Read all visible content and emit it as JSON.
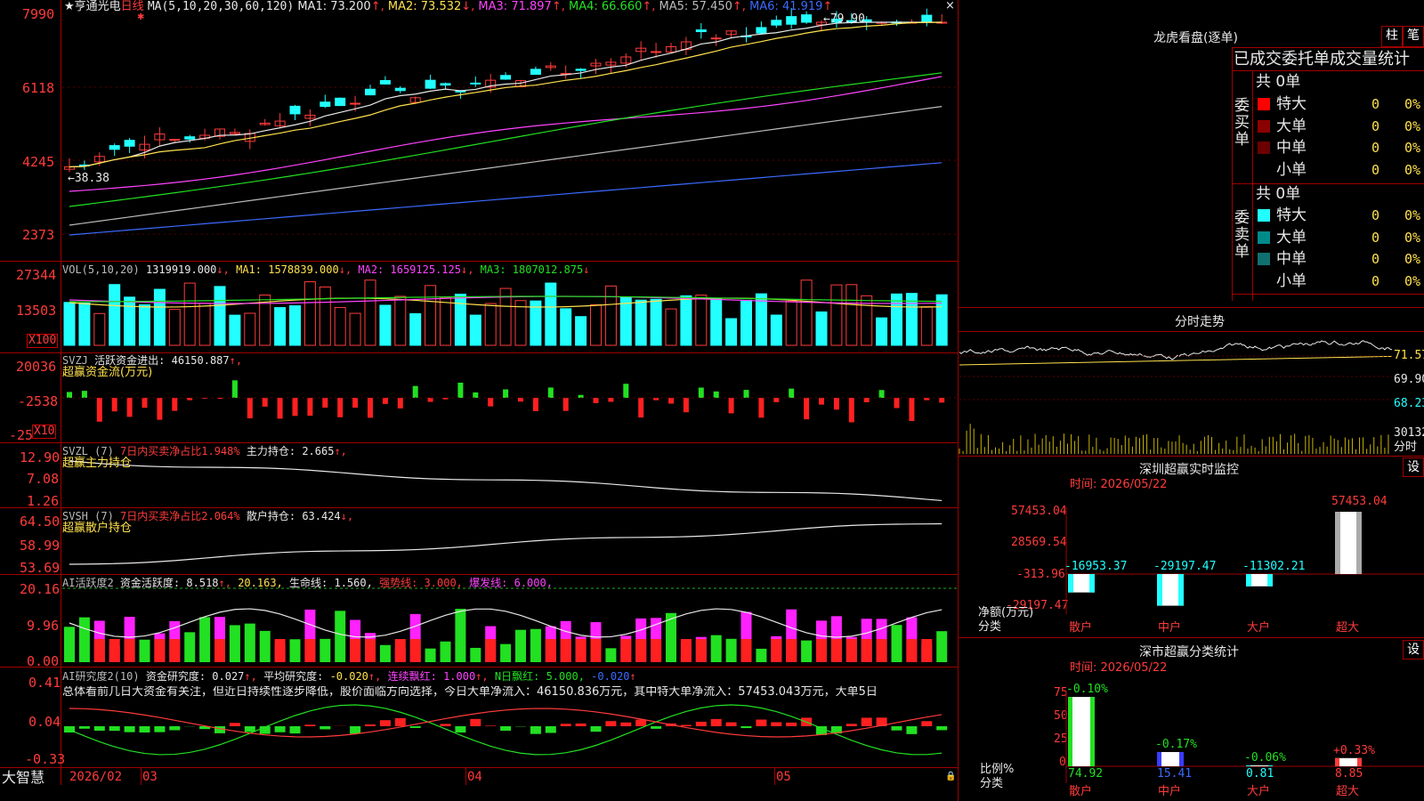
{
  "main": {
    "stock_name": "★亨通光电",
    "period": "日线",
    "ma_label": "MA(5,10,20,30,60,120)",
    "ma_values": [
      {
        "label": "MA1:",
        "value": "73.200",
        "arrow": "↑",
        "color": "#e8e8e8"
      },
      {
        "label": "MA2:",
        "value": "73.532",
        "arrow": "↓",
        "color": "#ffe14d"
      },
      {
        "label": "MA3:",
        "value": "71.897",
        "arrow": "↑",
        "color": "#ff44ff"
      },
      {
        "label": "MA4:",
        "value": "66.660",
        "arrow": "↑",
        "color": "#22e022"
      },
      {
        "label": "MA5:",
        "value": "57.450",
        "arrow": "↑",
        "color": "#bbbbbb"
      },
      {
        "label": "MA6:",
        "value": "41.919",
        "arrow": "↑",
        "color": "#3b6bff"
      }
    ],
    "y_labels": [
      "7990",
      "6118",
      "4245",
      "2373"
    ],
    "high_mark": "79.90",
    "low_mark": "38.38"
  },
  "vol": {
    "label": "VOL(5,10,20)",
    "value": "1319919.000",
    "ma": [
      {
        "label": "MA1:",
        "value": "1578839.000",
        "arrow": "↓",
        "color": "#ffe14d"
      },
      {
        "label": "MA2:",
        "value": "1659125.125",
        "arrow": "↓",
        "color": "#ff44ff"
      },
      {
        "label": "MA3:",
        "value": "1807012.875",
        "arrow": "↓",
        "color": "#22e022"
      }
    ],
    "y_labels": [
      "27344",
      "13503"
    ],
    "unit": "X100"
  },
  "svzj": {
    "label": "SVZJ",
    "desc": "活跃资金进出:",
    "value": "46150.887",
    "arrow": "↑,",
    "sub": "超赢资金流(万元)",
    "y_labels": [
      "20036",
      "-2538",
      "-25"
    ],
    "unit": "X10"
  },
  "svzl": {
    "label": "SVZL (7)",
    "desc": "7日内买卖净占比1.948%",
    "desc2": "主力持仓:",
    "value": "2.665",
    "arrow": "↑,",
    "sub": "超赢主力持仓",
    "y_labels": [
      "12.90",
      "7.08",
      "1.26"
    ]
  },
  "svsh": {
    "label": "SVSH (7)",
    "desc": "7日内买卖净占比2.064%",
    "desc2": "散户持仓:",
    "value": "63.424",
    "arrow": "↓,",
    "sub": "超赢散户持仓",
    "y_labels": [
      "64.50",
      "58.99",
      "53.69"
    ]
  },
  "ai1": {
    "label": "AI活跃度2",
    "desc": "资金活跃度:",
    "value": "8.518",
    "v2": "20.163,",
    "life_label": "生命线:",
    "life_value": "1.560,",
    "strong_label": "强势线:",
    "strong_value": "3.000,",
    "burst_label": "爆发线:",
    "burst_value": "6.000,",
    "y_labels": [
      "20.16",
      "9.96",
      "0.00"
    ]
  },
  "ai2": {
    "label": "AI研究度2(10)",
    "desc": "资金研究度:",
    "value": "0.027",
    "avg_label": "平均研究度:",
    "avg_value": "-0.020",
    "lx_label": "连续飘红:",
    "lx_value": "1.000",
    "n_label": "N日飘红:",
    "n_value": "5.000,",
    "last": "-0.020",
    "summary": "总体看前几日大资金有关注，但近日持续性逐步降低，股价面临方向选择，今日大单净流入：46150.836万元，其中特大单净流入：57453.043万元，大单5日",
    "y_labels": [
      "0.41",
      "0.04",
      "-0.33"
    ]
  },
  "xaxis": {
    "brand": "大智慧",
    "labels": [
      "2026/02",
      "03",
      "04",
      "05"
    ]
  },
  "right": {
    "dragon_title": "龙虎看盘(逐单)",
    "btn_zhu": "柱",
    "btn_bi": "笔",
    "tabs": [
      "已成交",
      "委托单",
      "成交量统计"
    ],
    "buy_side": "委买单",
    "sell_side": "委卖单",
    "buy_total": "共 0单",
    "sell_total": "共 0单",
    "buy_rows": [
      {
        "name": "特大",
        "count": "0",
        "pct": "0%",
        "color": "#ff0000"
      },
      {
        "name": "大单",
        "count": "0",
        "pct": "0%",
        "color": "#8b0000"
      },
      {
        "name": "中单",
        "count": "0",
        "pct": "0%",
        "color": "#6b0000"
      },
      {
        "name": "小单",
        "count": "0",
        "pct": "0%",
        "color": ""
      }
    ],
    "sell_rows": [
      {
        "name": "特大",
        "count": "0",
        "pct": "0%",
        "color": "#22ffff"
      },
      {
        "name": "大单",
        "count": "0",
        "pct": "0%",
        "color": "#008b8b"
      },
      {
        "name": "中单",
        "count": "0",
        "pct": "0%",
        "color": "#107070"
      },
      {
        "name": "小单",
        "count": "0",
        "pct": "0%",
        "color": ""
      }
    ],
    "intraday_title": "分时走势",
    "intraday_labels": [
      "71.57",
      "69.90",
      "68.23",
      "30132",
      "分时"
    ],
    "monitor_title": "深圳超赢实时监控",
    "monitor_btn": "设",
    "monitor_time": "时间: 2026/05/22",
    "monitor_y": [
      "57453.04",
      "28569.54",
      "-313.96",
      "-29197.47"
    ],
    "monitor_unit": "净额(万元)",
    "monitor_cat_label": "分类",
    "monitor_values": [
      "-16953.37",
      "-29197.47",
      "-11302.21",
      "57453.04"
    ],
    "categories": [
      "散户",
      "中户",
      "大户",
      "超大"
    ],
    "stat_title": "深市超赢分类统计",
    "stat_btn": "设",
    "stat_time": "时间: 2026/05/22",
    "stat_y": [
      "75",
      "50",
      "25",
      "0"
    ],
    "stat_pct": [
      "-0.10%",
      "-0.17%",
      "-0.06%",
      "+0.33%"
    ],
    "stat_values": [
      "74.92",
      "15.41",
      "0.81",
      "8.85"
    ],
    "stat_ratio_label": "比例%",
    "stat_cat_label": "分类"
  }
}
